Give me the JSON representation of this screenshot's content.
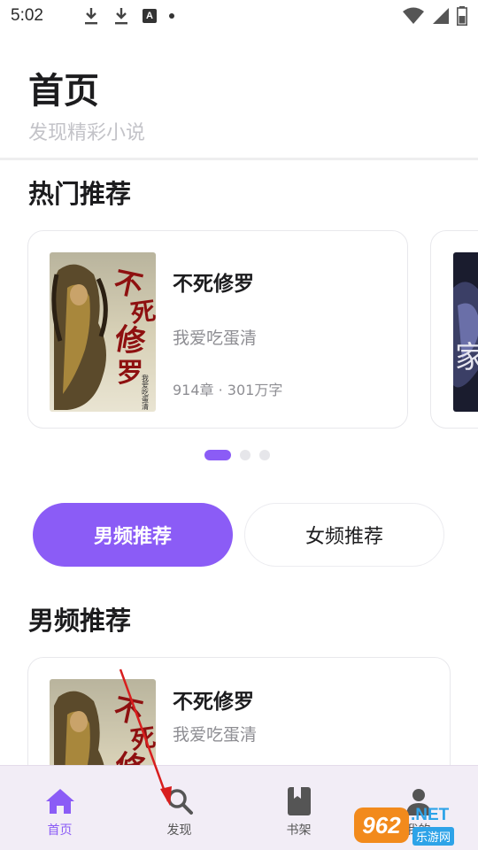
{
  "status_bar": {
    "time": "5:02",
    "icons": [
      "download-icon",
      "download-icon",
      "a-icon",
      "dot-icon",
      "wifi-icon",
      "signal-icon",
      "battery-icon"
    ]
  },
  "header": {
    "title": "首页",
    "subtitle": "发现精彩小说"
  },
  "hot": {
    "section_title": "热门推荐",
    "featured": {
      "title": "不死修罗",
      "author": "我爱吃蛋清",
      "stats": "914章 · 301万字",
      "cover_text": "不死修罗",
      "cover_author": "我爱吃蛋清"
    },
    "carousel_dots": 3,
    "active_dot": 0
  },
  "tabs": {
    "male": "男频推荐",
    "female": "女频推荐",
    "selected": "male"
  },
  "male": {
    "section_title": "男频推荐",
    "items": [
      {
        "title": "不死修罗",
        "author": "我爱吃蛋清"
      }
    ]
  },
  "bottom_nav": [
    {
      "label": "首页",
      "icon": "home-icon",
      "active": true
    },
    {
      "label": "发现",
      "icon": "search-icon",
      "active": false
    },
    {
      "label": "书架",
      "icon": "book-icon",
      "active": false
    },
    {
      "label": "我的",
      "icon": "person-icon",
      "active": false
    }
  ],
  "watermark": {
    "badge": "962",
    "net": ".NET",
    "site": "乐游网"
  },
  "colors": {
    "accent": "#8b5cf6",
    "nav_bg": "#f2edf6"
  }
}
